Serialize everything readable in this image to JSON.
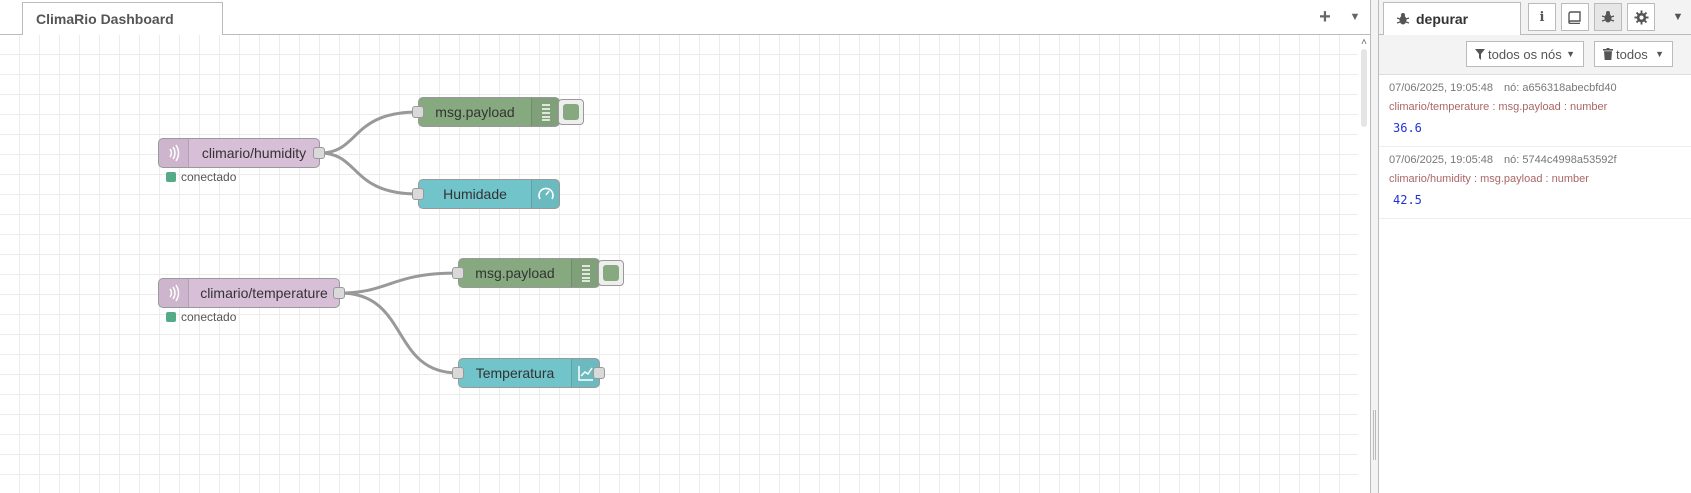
{
  "workspace": {
    "flow_tab": "ClimaRio Dashboard",
    "add_icon": "plus-icon",
    "menu_icon": "caret-down-icon"
  },
  "nodes": {
    "humidity_in": {
      "label": "climario/humidity",
      "status": "conectado",
      "icon": "mqtt-icon"
    },
    "humidity_debug": {
      "label": "msg.payload",
      "icon": "list-icon"
    },
    "humidity_gauge": {
      "label": "Humidade",
      "icon": "gauge-icon"
    },
    "temperature_in": {
      "label": "climario/temperature",
      "status": "conectado",
      "icon": "mqtt-icon"
    },
    "temperature_debug": {
      "label": "msg.payload",
      "icon": "list-icon"
    },
    "temperature_chart": {
      "label": "Temperatura",
      "icon": "chart-icon"
    }
  },
  "sidebar": {
    "active_tab": "depurar",
    "info_label": "i",
    "filter_label": "todos os nós",
    "clear_label": "todos",
    "messages": [
      {
        "timestamp": "07/06/2025, 19:05:48",
        "node": "nó: a656318abecbfd40",
        "topic": "climario/temperature : msg.payload : number",
        "value": "36.6"
      },
      {
        "timestamp": "07/06/2025, 19:05:48",
        "node": "nó: 5744c4998a53592f",
        "topic": "climario/humidity : msg.payload : number",
        "value": "42.5"
      }
    ]
  },
  "colors": {
    "mqtt_node": "#d8bfd8",
    "debug_node": "#87a980",
    "ui_node": "#70c4ca",
    "status_connected": "#55aa88",
    "debug_value": "#2033d6",
    "debug_topic": "#aa6666"
  }
}
